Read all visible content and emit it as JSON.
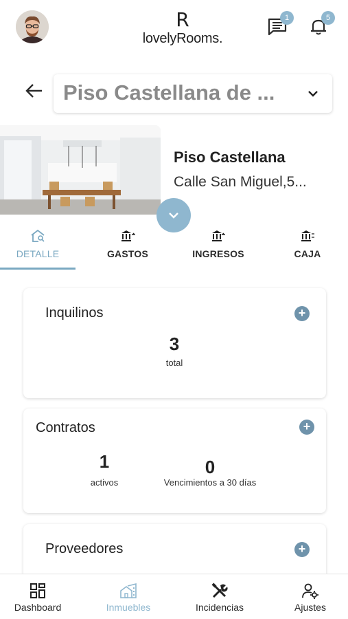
{
  "header": {
    "logo_mark": "R",
    "logo_text": "lovelyRooms.",
    "messages_badge": "1",
    "notifications_badge": "5"
  },
  "property_selector": {
    "value": "Piso Castellana de ..."
  },
  "property": {
    "name": "Piso Castellana",
    "address": "Calle San Miguel,5..."
  },
  "tabs": [
    {
      "label": "DETALLE",
      "active": true
    },
    {
      "label": "GASTOS",
      "active": false
    },
    {
      "label": "INGRESOS",
      "active": false
    },
    {
      "label": "CAJA",
      "active": false
    }
  ],
  "cards": {
    "inquilinos": {
      "title": "Inquilinos",
      "total_value": "3",
      "total_label": "total"
    },
    "contratos": {
      "title": "Contratos",
      "activos_value": "1",
      "activos_label": "activos",
      "vencimientos_value": "0",
      "vencimientos_label": "Vencimientos a 30 días"
    },
    "proveedores": {
      "title": "Proveedores"
    }
  },
  "bottom_nav": [
    {
      "label": "Dashboard",
      "icon": "dashboard-icon",
      "active": false
    },
    {
      "label": "Inmuebles",
      "icon": "building-icon",
      "active": true
    },
    {
      "label": "Incidencias",
      "icon": "tools-icon",
      "active": false
    },
    {
      "label": "Ajustes",
      "icon": "user-gear-icon",
      "active": false
    }
  ],
  "colors": {
    "accent": "#8fb7cf",
    "accent_dark": "#6f93ab",
    "tab_active": "#7aa8c1",
    "text": "#2b2b2b"
  }
}
